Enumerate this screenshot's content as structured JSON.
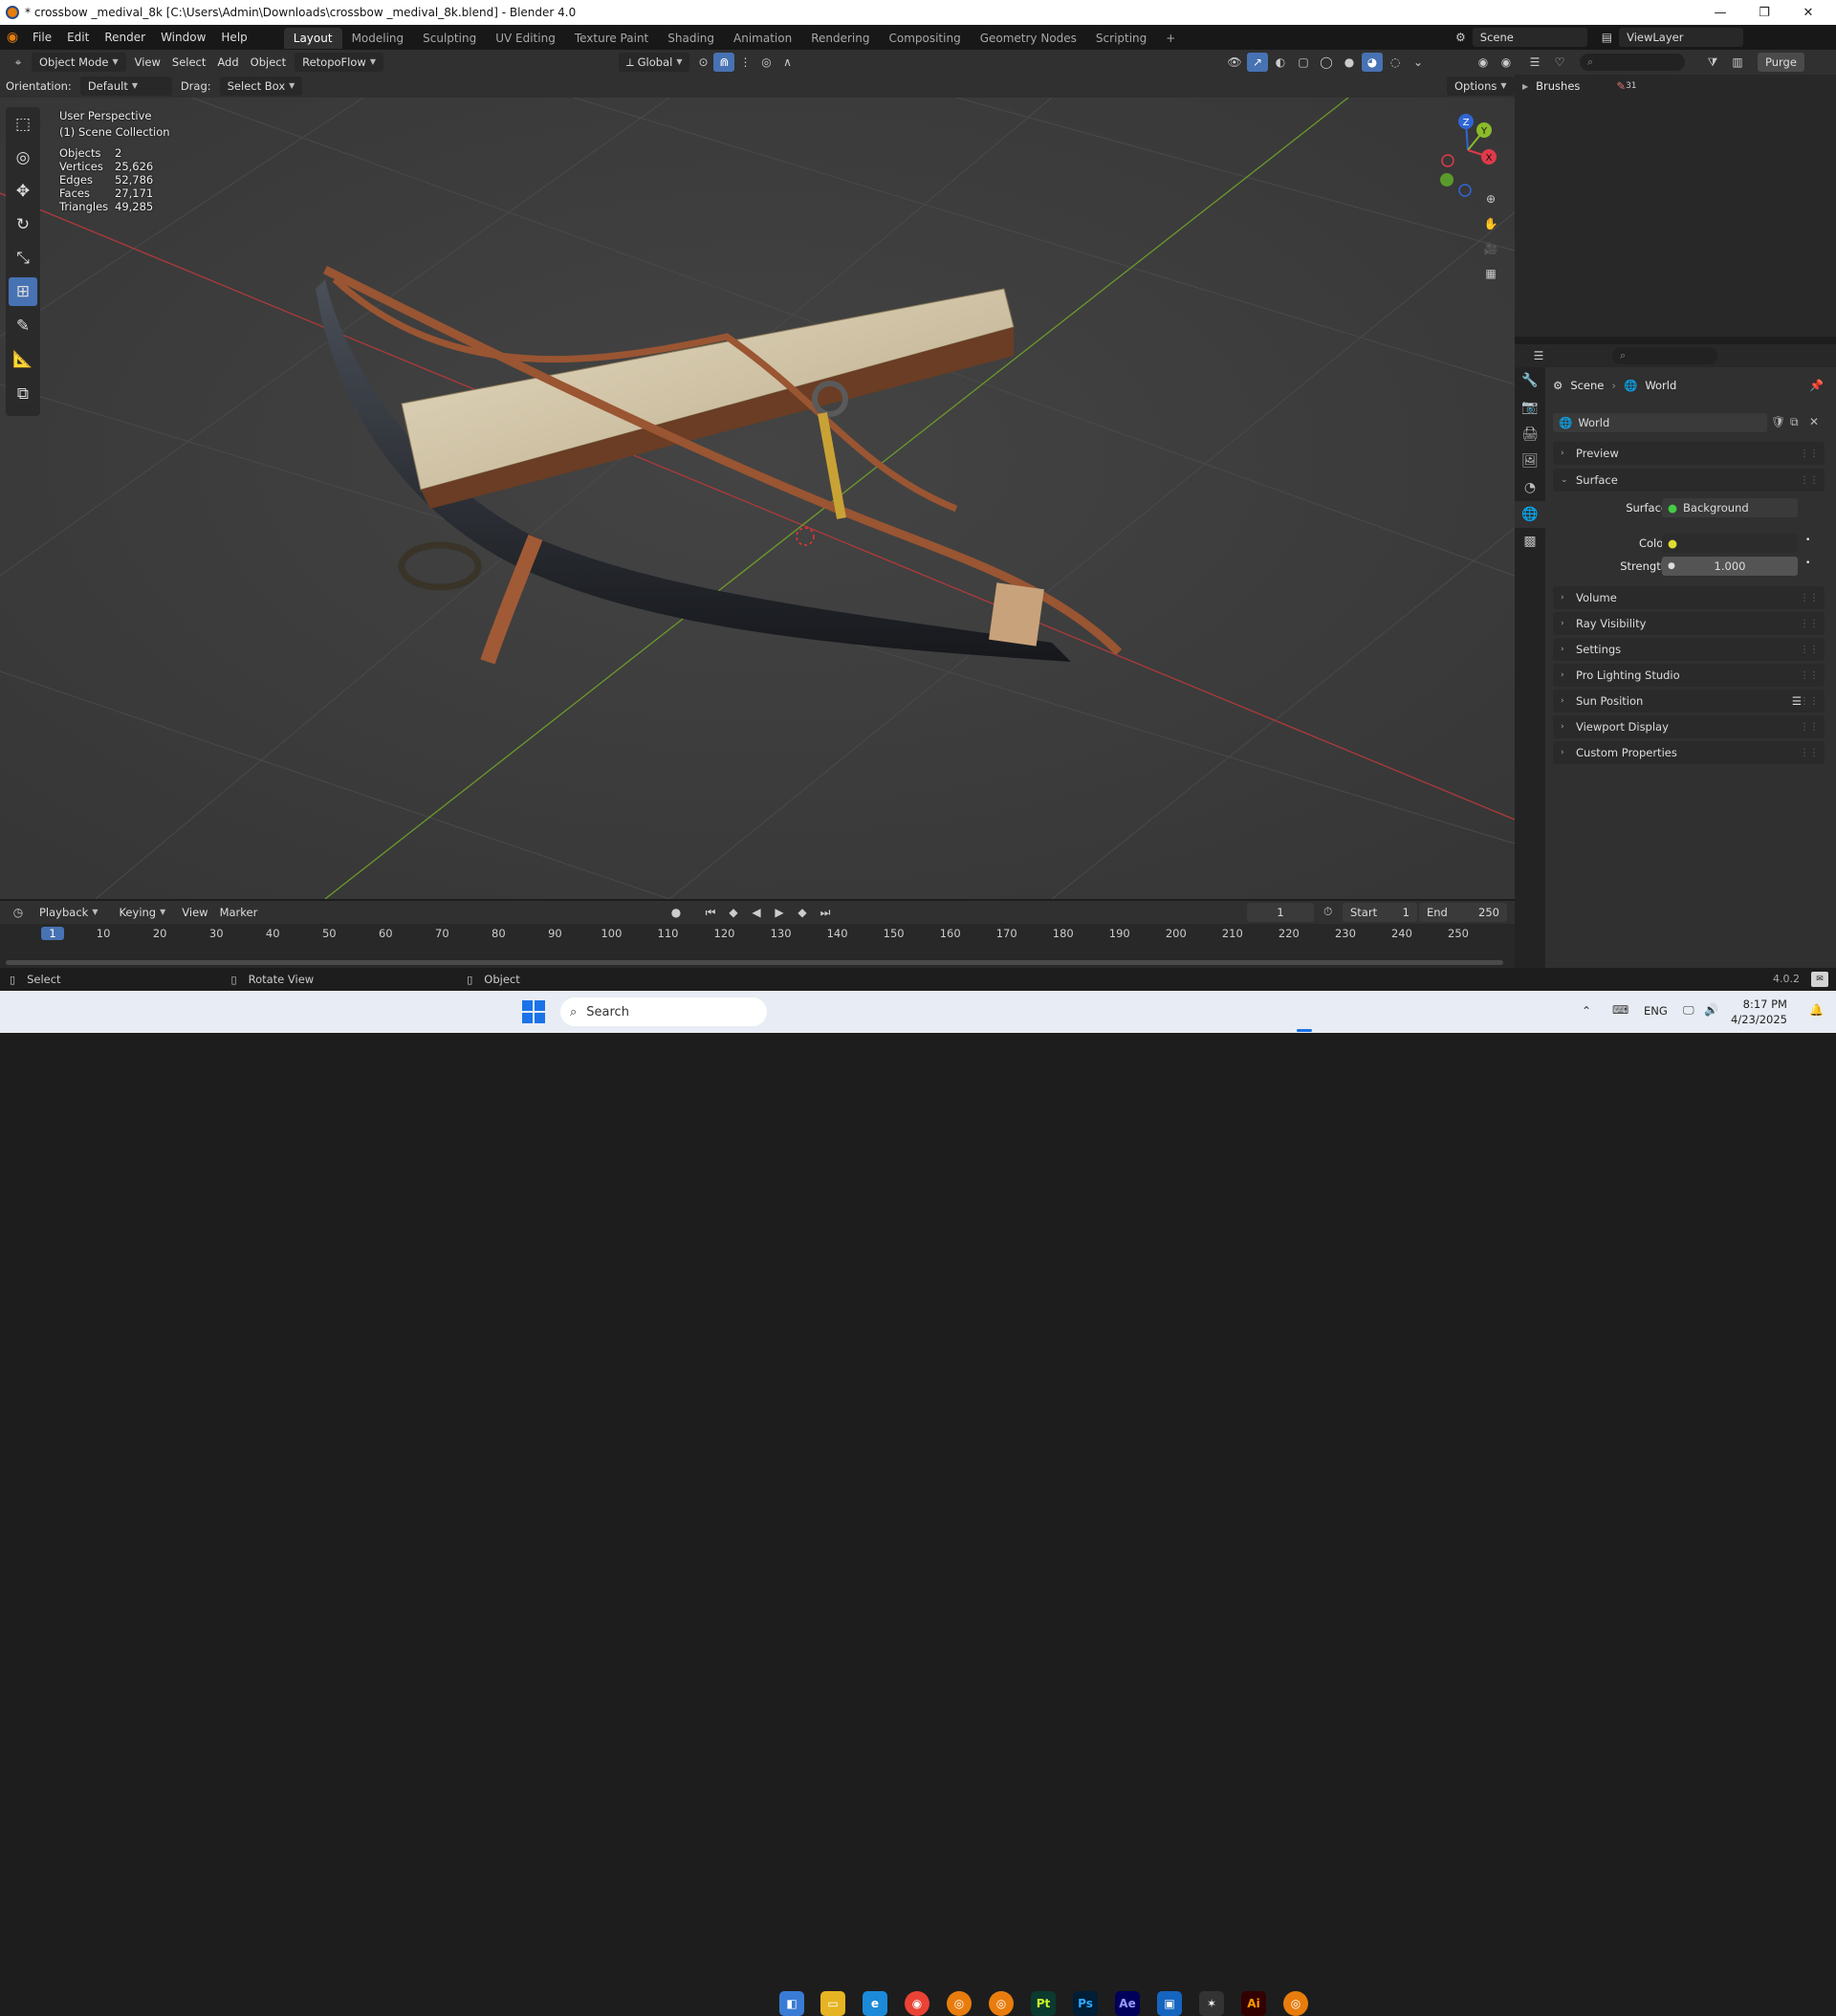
{
  "window": {
    "title": "* crossbow _medival_8k [C:\\Users\\Admin\\Downloads\\crossbow _medival_8k.blend] - Blender 4.0",
    "controls": [
      "—",
      "❐",
      "✕"
    ]
  },
  "menu": [
    "File",
    "Edit",
    "Render",
    "Window",
    "Help"
  ],
  "workspaces": [
    "Layout",
    "Modeling",
    "Sculpting",
    "UV Editing",
    "Texture Paint",
    "Shading",
    "Animation",
    "Rendering",
    "Compositing",
    "Geometry Nodes",
    "Scripting"
  ],
  "workspace_add": "+",
  "scene_field": "Scene",
  "viewlayer_field": "ViewLayer",
  "header": {
    "mode": "Object Mode",
    "view": "View",
    "select": "Select",
    "add": "Add",
    "object": "Object",
    "addon": "RetopoFlow",
    "transform": "Global",
    "orientation_label": "Orientation:",
    "orientation_value": "Default",
    "drag_label": "Drag:",
    "drag_value": "Select Box",
    "options": "Options"
  },
  "viewport": {
    "perspective": "User Perspective",
    "collection": "(1) Scene Collection",
    "stats": [
      {
        "label": "Objects",
        "value": "2"
      },
      {
        "label": "Vertices",
        "value": "25,626"
      },
      {
        "label": "Edges",
        "value": "52,786"
      },
      {
        "label": "Faces",
        "value": "27,171"
      },
      {
        "label": "Triangles",
        "value": "49,285"
      }
    ],
    "gizmo": {
      "z": "Z",
      "y": "Y",
      "x": "X"
    }
  },
  "outliner": {
    "purge": "Purge",
    "item": "Brushes",
    "item_count": "31"
  },
  "properties": {
    "breadcrumb_scene": "Scene",
    "breadcrumb_world": "World",
    "world_name": "World",
    "panels_top": [
      "Preview",
      "Surface"
    ],
    "surface_label": "Surface",
    "surface_value": "Background",
    "color_label": "Color",
    "strength_label": "Strength",
    "strength_value": "1.000",
    "panels": [
      "Volume",
      "Ray Visibility",
      "Settings",
      "Pro Lighting Studio",
      "Sun Position",
      "Viewport Display",
      "Custom Properties"
    ]
  },
  "timeline": {
    "playback": "Playback",
    "keying": "Keying",
    "view": "View",
    "marker": "Marker",
    "current_frame": "1",
    "start_label": "Start",
    "start_value": "1",
    "end_label": "End",
    "end_value": "250",
    "ticks": [
      "1",
      "10",
      "20",
      "30",
      "40",
      "50",
      "60",
      "70",
      "80",
      "90",
      "100",
      "110",
      "120",
      "130",
      "140",
      "150",
      "160",
      "170",
      "180",
      "190",
      "200",
      "210",
      "220",
      "230",
      "240",
      "250"
    ]
  },
  "status": {
    "select": "Select",
    "rotate": "Rotate View",
    "object": "Object",
    "version": "4.0.2"
  },
  "taskbar": {
    "search": "Search",
    "lang": "ENG",
    "time": "8:17 PM",
    "date": "4/23/2025",
    "apps": [
      "Pt",
      "Ps",
      "Ae",
      "Ai"
    ]
  }
}
